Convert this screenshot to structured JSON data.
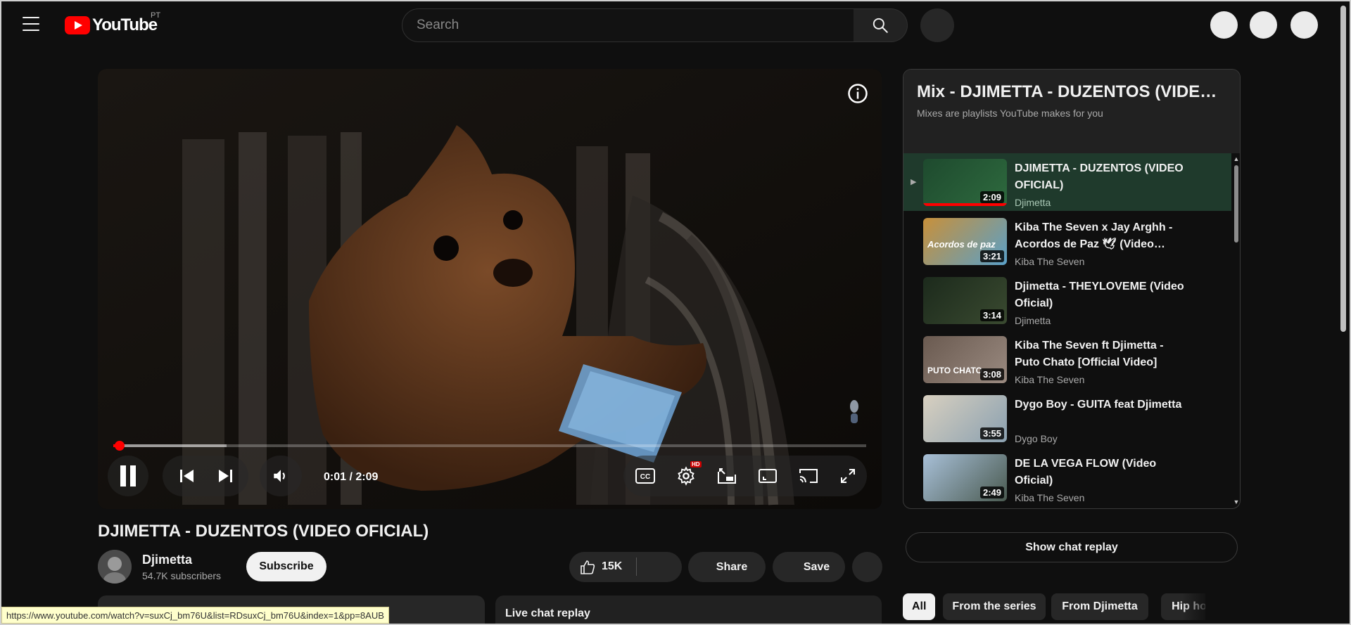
{
  "header": {
    "logo_text": "YouTube",
    "region": "PT",
    "search_placeholder": "Search"
  },
  "player": {
    "current_time": "0:01",
    "duration": "2:09",
    "time_display": "0:01 / 2:09",
    "progress_fraction": 0.008,
    "buffer_fraction": 0.15,
    "settings_badge": "HD"
  },
  "video": {
    "title": "DJIMETTA - DUZENTOS (VIDEO OFICIAL)",
    "channel": "Djimetta",
    "subscribers": "54.7K subscribers",
    "subscribe_label": "Subscribe",
    "likes": "15K",
    "share_label": "Share",
    "save_label": "Save"
  },
  "status_url": "https://www.youtube.com/watch?v=suxCj_bm76U&list=RDsuxCj_bm76U&index=1&pp=8AUB",
  "chat": {
    "live_label": "Live chat replay",
    "show_label": "Show chat replay"
  },
  "playlist": {
    "title": "Mix - DJIMETTA - DUZENTOS (VIDE…",
    "subtitle": "Mixes are playlists YouTube makes for you",
    "items": [
      {
        "title": "DJIMETTA - DUZENTOS (VIDEO OFICIAL)",
        "channel": "Djimetta",
        "duration": "2:09",
        "active": true
      },
      {
        "title": "Kiba The Seven x Jay Arghh - Acordos de Paz 🕊 (Video…",
        "channel": "Kiba The Seven",
        "duration": "3:21",
        "active": false
      },
      {
        "title": "Djimetta - THEYLOVEME (Video Oficial)",
        "channel": "Djimetta",
        "duration": "3:14",
        "active": false
      },
      {
        "title": "Kiba The Seven ft Djimetta - Puto Chato [Official Video]",
        "channel": "Kiba The Seven",
        "duration": "3:08",
        "active": false
      },
      {
        "title": "Dygo Boy - GUITA feat Djimetta",
        "channel": "Dygo Boy",
        "duration": "3:55",
        "active": false
      },
      {
        "title": "DE LA VEGA FLOW (Video Oficial)",
        "channel": "Kiba The Seven",
        "duration": "2:49",
        "active": false
      }
    ],
    "thumb_texts": [
      "",
      "Acordos de paz",
      "",
      "PUTO CHATO",
      "",
      ""
    ]
  },
  "chips": [
    "All",
    "From the series",
    "From Djimetta",
    "Hip ho"
  ]
}
